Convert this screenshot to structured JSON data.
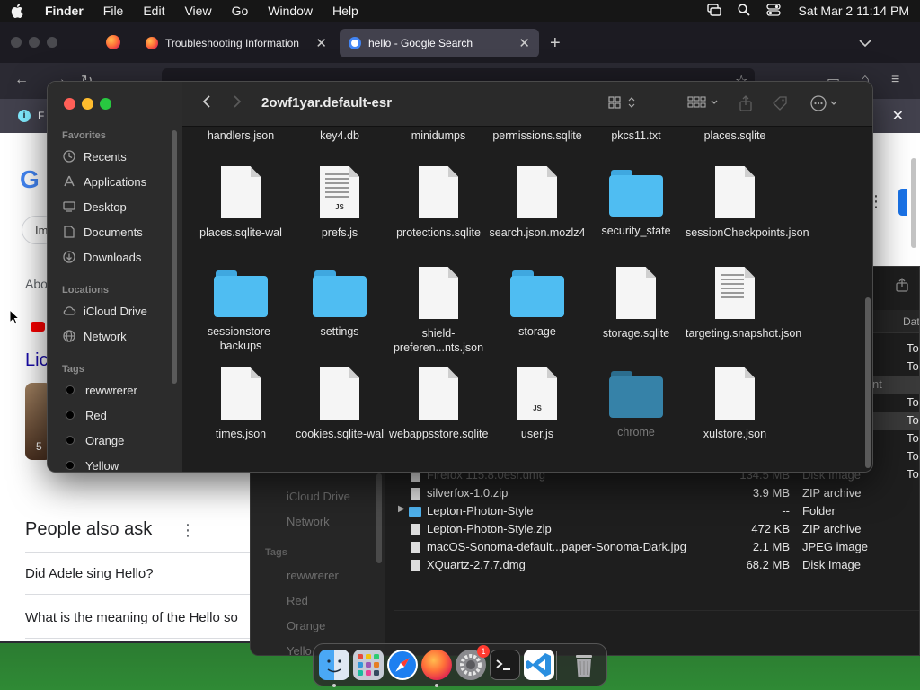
{
  "menubar": {
    "app": "Finder",
    "items": [
      "File",
      "Edit",
      "View",
      "Go",
      "Window",
      "Help"
    ],
    "clock": "Sat Mar 2  11:14 PM"
  },
  "browser": {
    "tabs": [
      {
        "title": "Troubleshooting Information"
      },
      {
        "title": "hello - Google Search"
      }
    ],
    "infobar_text": "F",
    "page": {
      "logo": "G",
      "chip": "Im",
      "about": "Abo",
      "link": "Lic",
      "thumb_text": "5",
      "people_also_ask": "People also ask",
      "questions": [
        "Did Adele sing Hello?",
        "What is the meaning of the Hello so"
      ]
    }
  },
  "finder_back": {
    "sidebar": {
      "locations": [
        "iCloud Drive",
        "Network"
      ],
      "tags_header": "Tags",
      "tags": [
        "rewwrerer",
        "Red",
        "Orange",
        "Yello"
      ]
    },
    "columns": {
      "date": "Dat"
    },
    "rows": [
      {
        "name": "Firefox 115.8.0esr.dmg",
        "size": "134.5 MB",
        "kind": "Disk Image",
        "date": "Tod",
        "dim": true,
        "folder": false
      },
      {
        "name": "silverfox-1.0.zip",
        "size": "3.9 MB",
        "kind": "ZIP archive",
        "date": "Tod",
        "dim": false,
        "folder": false
      },
      {
        "name": "Lepton-Photon-Style",
        "size": "--",
        "kind": "Folder",
        "date": "Tod",
        "dim": false,
        "folder": true
      },
      {
        "name": "Lepton-Photon-Style.zip",
        "size": "472 KB",
        "kind": "ZIP archive",
        "date": "Tod",
        "dim": false,
        "folder": false
      },
      {
        "name": "macOS-Sonoma-default...paper-Sonoma-Dark.jpg",
        "size": "2.1 MB",
        "kind": "JPEG image",
        "date": "Tod",
        "dim": false,
        "folder": false
      },
      {
        "name": "XQuartz-2.7.7.dmg",
        "size": "68.2 MB",
        "kind": "Disk Image",
        "date": "Tod",
        "dim": false,
        "folder": false
      }
    ],
    "right_col_dates": [
      "Tod",
      "Tod",
      "nt",
      "Tod",
      "Tod",
      "Tod",
      "Tod",
      "Tod"
    ]
  },
  "finder": {
    "title": "2owf1yar.default-esr",
    "sidebar": {
      "favorites_header": "Favorites",
      "favorites": [
        {
          "label": "Recents",
          "icon": "clock-icon"
        },
        {
          "label": "Applications",
          "icon": "applications-icon"
        },
        {
          "label": "Desktop",
          "icon": "desktop-icon"
        },
        {
          "label": "Documents",
          "icon": "document-icon"
        },
        {
          "label": "Downloads",
          "icon": "download-icon"
        }
      ],
      "locations_header": "Locations",
      "locations": [
        {
          "label": "iCloud Drive",
          "icon": "cloud-icon"
        },
        {
          "label": "Network",
          "icon": "globe-icon"
        }
      ],
      "tags_header": "Tags",
      "tags": [
        {
          "label": "rewwrerer",
          "color": "#000000"
        },
        {
          "label": "Red",
          "color": "#000000"
        },
        {
          "label": "Orange",
          "color": "#000000"
        },
        {
          "label": "Yellow",
          "color": "#000000"
        }
      ]
    },
    "partial_row": [
      "handlers.json",
      "key4.db",
      "minidumps",
      "permissions.sqlite",
      "pkcs11.txt",
      "places.sqlite"
    ],
    "items": [
      {
        "name": "places.sqlite-wal",
        "type": "doc"
      },
      {
        "name": "prefs.js",
        "type": "js-lines"
      },
      {
        "name": "protections.sqlite",
        "type": "doc"
      },
      {
        "name": "search.json.mozlz4",
        "type": "doc"
      },
      {
        "name": "security_state",
        "type": "folder"
      },
      {
        "name": "sessionCheckpoints.json",
        "type": "doc"
      },
      {
        "name": "sessionstore-backups",
        "type": "folder"
      },
      {
        "name": "settings",
        "type": "folder"
      },
      {
        "name": "shield-preferen...nts.json",
        "type": "doc"
      },
      {
        "name": "storage",
        "type": "folder"
      },
      {
        "name": "storage.sqlite",
        "type": "doc"
      },
      {
        "name": "targeting.snapshot.json",
        "type": "doc-lines"
      },
      {
        "name": "times.json",
        "type": "doc"
      },
      {
        "name": "cookies.sqlite-wal",
        "type": "doc"
      },
      {
        "name": "webappsstore.sqlite",
        "type": "doc"
      },
      {
        "name": "user.js",
        "type": "js"
      },
      {
        "name": "chrome",
        "type": "folder-dark"
      },
      {
        "name": "xulstore.json",
        "type": "doc"
      }
    ]
  },
  "dock": {
    "apps": [
      {
        "name": "finder",
        "color": "#2e8ef0",
        "running": true
      },
      {
        "name": "launchpad",
        "color": "#9aa3b5",
        "running": false
      },
      {
        "name": "safari",
        "color": "#1d7ff0",
        "running": false
      },
      {
        "name": "firefox",
        "color": "#ff7139",
        "running": true
      },
      {
        "name": "system-settings",
        "color": "#8a8a8e",
        "running": false,
        "badge": "1"
      },
      {
        "name": "terminal",
        "color": "#1b1b1b",
        "running": false
      },
      {
        "name": "vscode",
        "color": "#2a8fe0",
        "running": false
      },
      {
        "name": "trash",
        "color": "#a9a9ad",
        "running": false
      }
    ]
  }
}
